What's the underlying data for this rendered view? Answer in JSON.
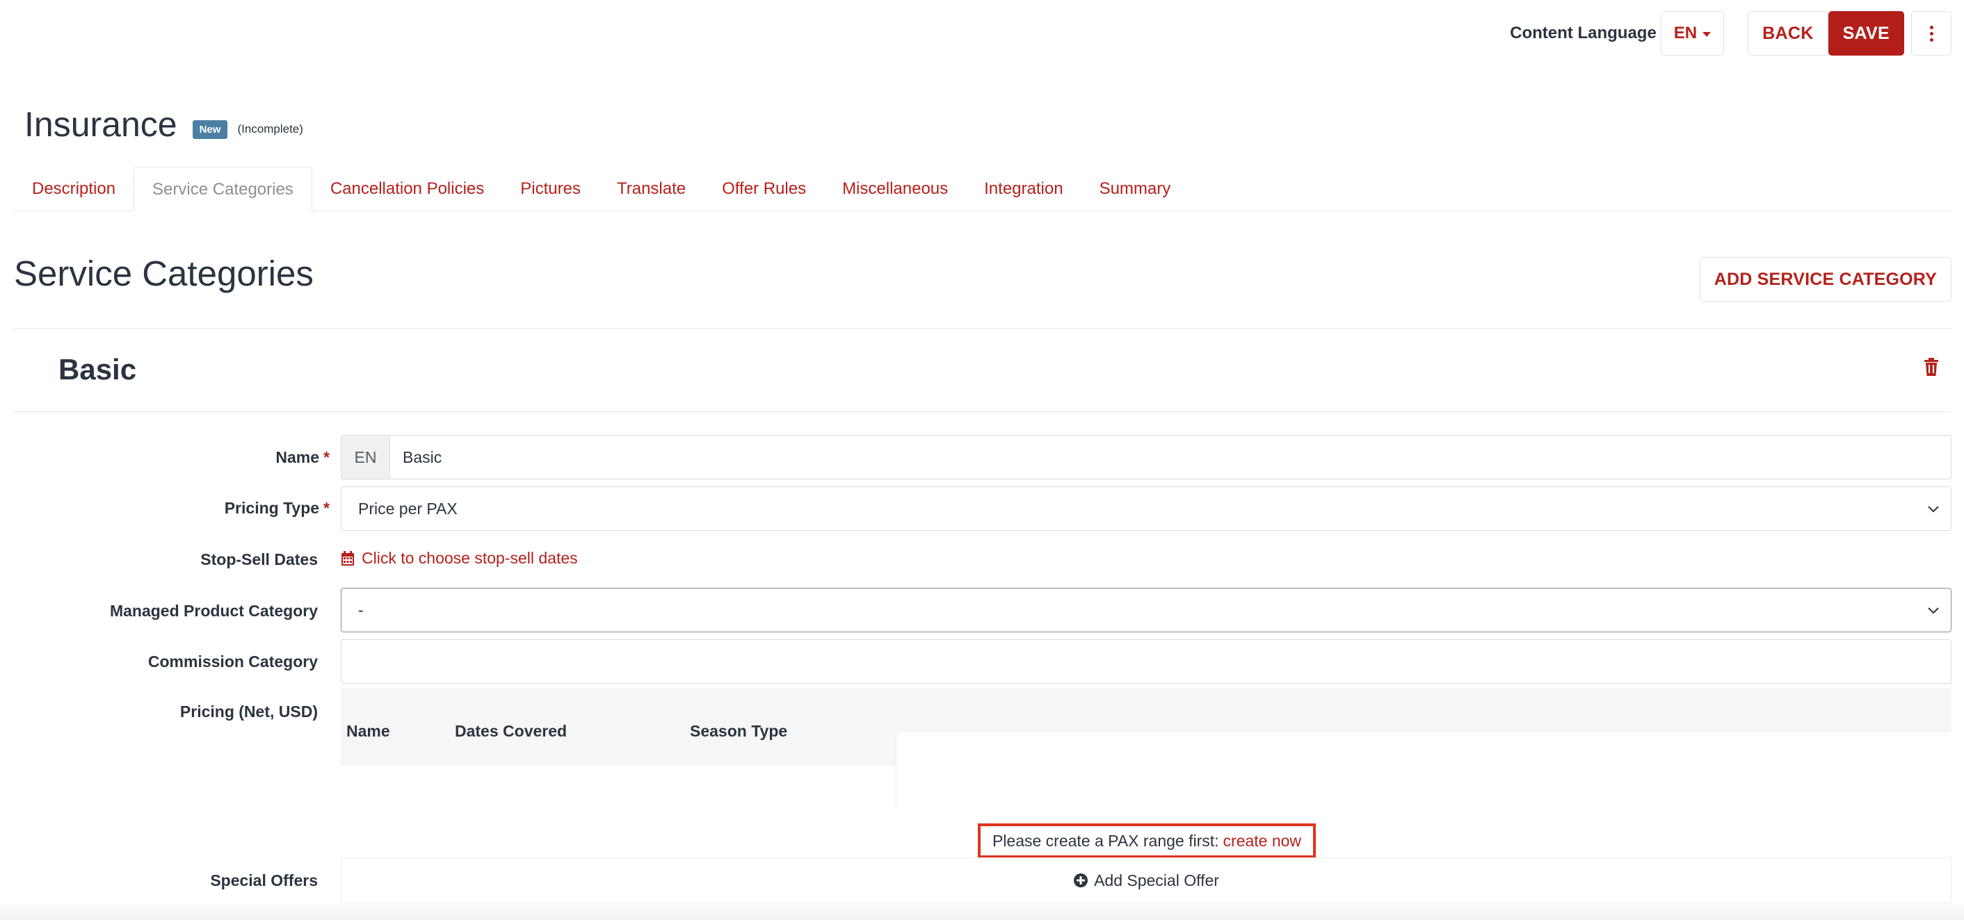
{
  "header": {
    "content_language_label": "Content Language",
    "language_value": "EN",
    "back_label": "BACK",
    "save_label": "SAVE"
  },
  "page": {
    "title": "Insurance",
    "badge": "New",
    "status": "(Incomplete)"
  },
  "tabs": [
    {
      "label": "Description",
      "active": false
    },
    {
      "label": "Service Categories",
      "active": true
    },
    {
      "label": "Cancellation Policies",
      "active": false
    },
    {
      "label": "Pictures",
      "active": false
    },
    {
      "label": "Translate",
      "active": false
    },
    {
      "label": "Offer Rules",
      "active": false
    },
    {
      "label": "Miscellaneous",
      "active": false
    },
    {
      "label": "Integration",
      "active": false
    },
    {
      "label": "Summary",
      "active": false
    }
  ],
  "section": {
    "title": "Service Categories",
    "add_button_label": "ADD SERVICE CATEGORY"
  },
  "category": {
    "title": "Basic",
    "fields": {
      "name_label": "Name",
      "name_prefix": "EN",
      "name_value": "Basic",
      "pricing_type_label": "Pricing Type",
      "pricing_type_value": "Price per PAX",
      "stop_sell_label": "Stop-Sell Dates",
      "stop_sell_link": "Click to choose stop-sell dates",
      "managed_label": "Managed Product Category",
      "managed_value": "-",
      "commission_label": "Commission Category",
      "commission_value": "",
      "pricing_label": "Pricing (Net, USD)",
      "special_offers_label": "Special Offers",
      "required_marker": "*"
    },
    "pricing_table": {
      "columns": [
        "Name",
        "Dates Covered",
        "Season Type"
      ]
    },
    "pax_notice": {
      "text": "Please create a PAX range first:",
      "link": "create now"
    },
    "special_offers": {
      "add_label": "Add Special Offer"
    }
  },
  "colors": {
    "accent": "#b5211c",
    "badge": "#4a7fa3",
    "highlight_border": "#e0341f"
  },
  "icons": [
    "caret-down-icon",
    "kebab-menu-icon",
    "trash-icon",
    "calendar-icon",
    "chevron-down-icon",
    "plus-circle-icon"
  ]
}
